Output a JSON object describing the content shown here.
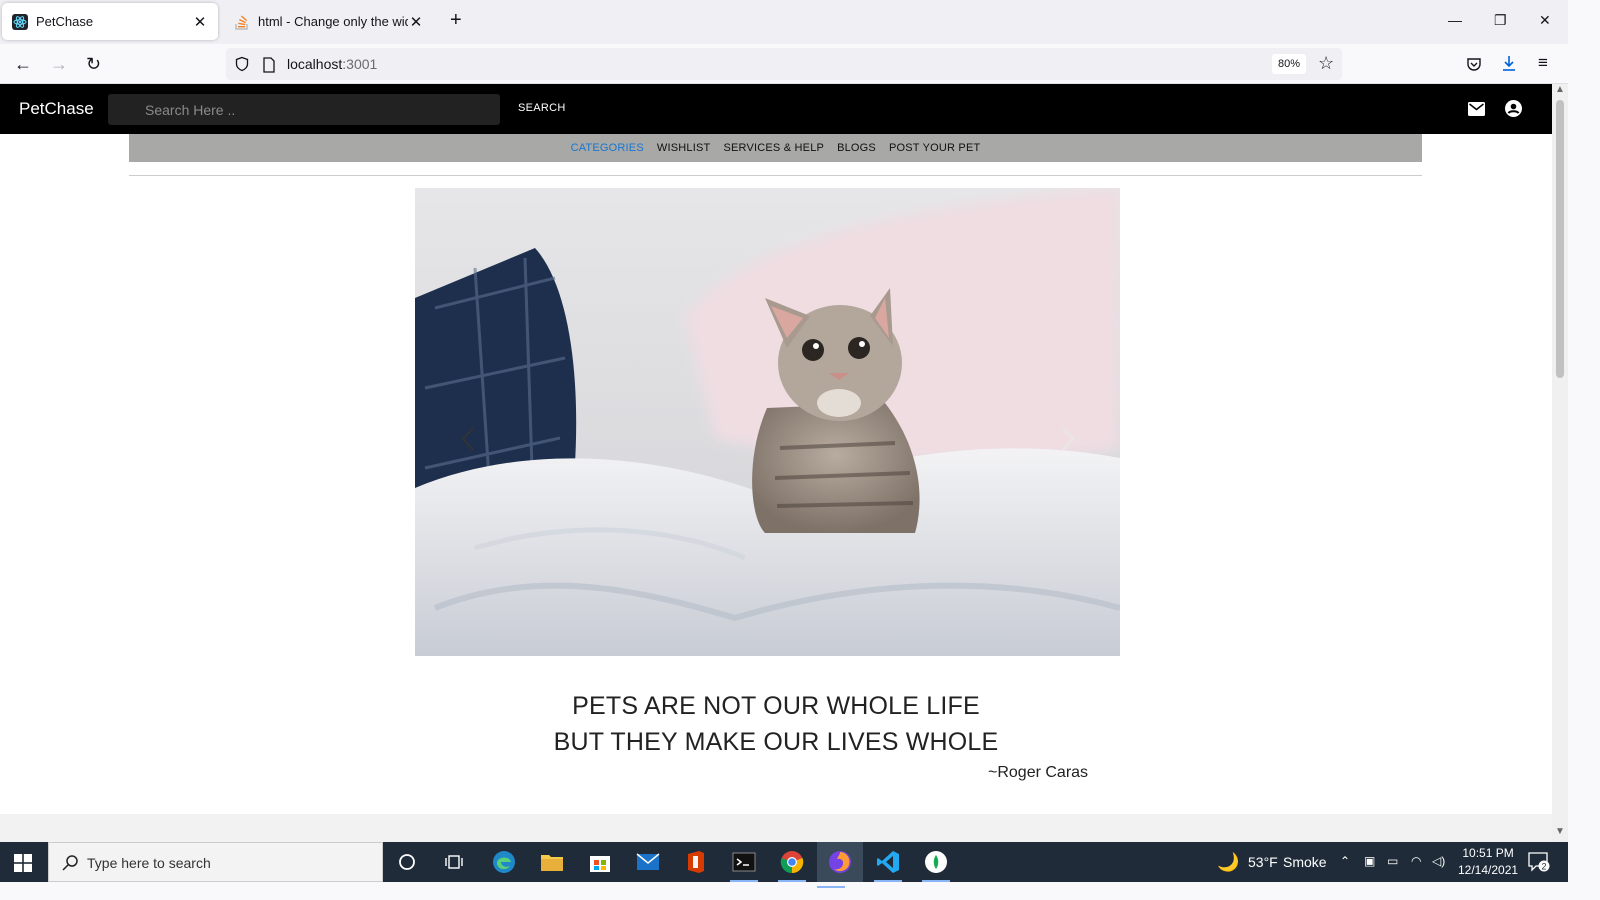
{
  "browser": {
    "tabs": [
      {
        "title": "PetChase",
        "active": true
      },
      {
        "title": "html - Change only the width of",
        "active": false
      }
    ],
    "url_host": "localhost",
    "url_port": ":3001",
    "zoom": "80%"
  },
  "app": {
    "brand": "PetChase",
    "search_placeholder": "Search Here ..",
    "search_button": "SEARCH",
    "categories": [
      {
        "label": "CATEGORIES",
        "active": true
      },
      {
        "label": "WISHLIST",
        "active": false
      },
      {
        "label": "SERVICES & HELP",
        "active": false
      },
      {
        "label": "BLOGS",
        "active": false
      },
      {
        "label": "POST YOUR PET",
        "active": false
      }
    ],
    "active_color": "#1976d2",
    "quote_line1": "PETS ARE NOT OUR WHOLE LIFE",
    "quote_line2": "BUT THEY MAKE OUR LIVES WHOLE",
    "quote_author": "~Roger Caras"
  },
  "taskbar": {
    "search_placeholder": "Type here to search",
    "weather_temp": "53°F",
    "weather_desc": "Smoke",
    "time": "10:51 PM",
    "date": "12/14/2021",
    "notification_count": "2"
  }
}
